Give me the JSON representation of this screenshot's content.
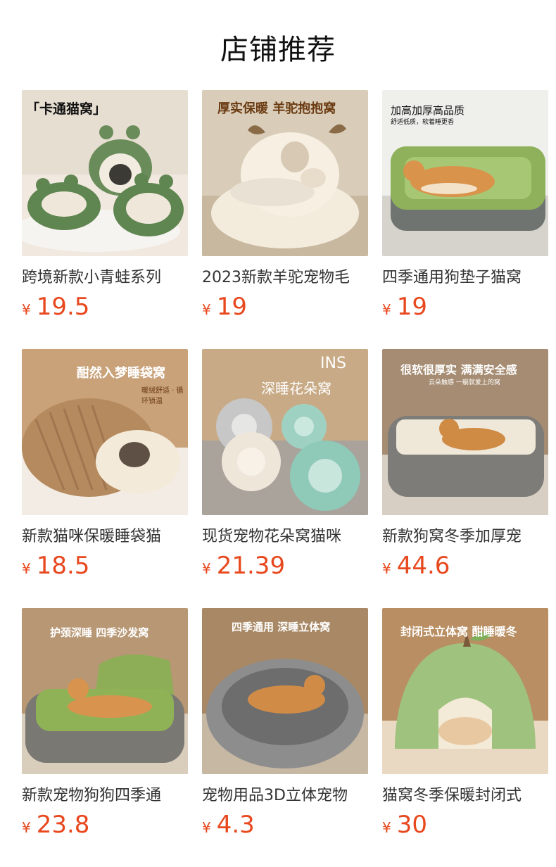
{
  "page_title": "店铺推荐",
  "currency": "¥",
  "products": [
    {
      "title": "跨境新款小青蛙系列",
      "price": "19.5",
      "img_text": "「卡通猫窝」",
      "img_text2": "",
      "icon": "frog-bed-image"
    },
    {
      "title": "2023新款羊驼宠物毛",
      "price": "19",
      "img_text": "厚实保暖 羊驼抱抱窝",
      "img_text2": "",
      "icon": "alpaca-bed-image"
    },
    {
      "title": "四季通用狗垫子猫窝",
      "price": "19",
      "img_text": "加高加厚高品质",
      "img_text2": "舒适低质，软着睡更香",
      "icon": "green-dog-mat-image"
    },
    {
      "title": "新款猫咪保暖睡袋猫",
      "price": "18.5",
      "img_text": "酣然入梦睡袋窝",
      "img_text2": "暖绒舒适 · 循环锁温",
      "icon": "sleeping-bag-bed-image"
    },
    {
      "title": "现货宠物花朵窝猫咪",
      "price": "21.39",
      "img_text": "INS",
      "img_text2": "深睡花朵窝",
      "icon": "flower-bed-image"
    },
    {
      "title": "新款狗窝冬季加厚宠",
      "price": "44.6",
      "img_text": "很软很厚实 满满安全感",
      "img_text2": "云朵触感 一躺就爱上的窝",
      "icon": "corduroy-dog-bed-image"
    },
    {
      "title": "新款宠物狗狗四季通",
      "price": "23.8",
      "img_text": "护颈深睡 四季沙发窝",
      "img_text2": "",
      "icon": "sofa-bed-image"
    },
    {
      "title": "宠物用品3D立体宠物",
      "price": "4.3",
      "img_text": "四季通用 深睡立体窝",
      "img_text2": "",
      "icon": "grey-3d-bed-image"
    },
    {
      "title": "猫窝冬季保暖封闭式",
      "price": "30",
      "img_text": "封闭式立体窝 酣睡暖冬",
      "img_text2": "",
      "icon": "pear-cave-bed-image"
    }
  ],
  "colors": {
    "price": "#e8481e",
    "title": "#333333"
  }
}
